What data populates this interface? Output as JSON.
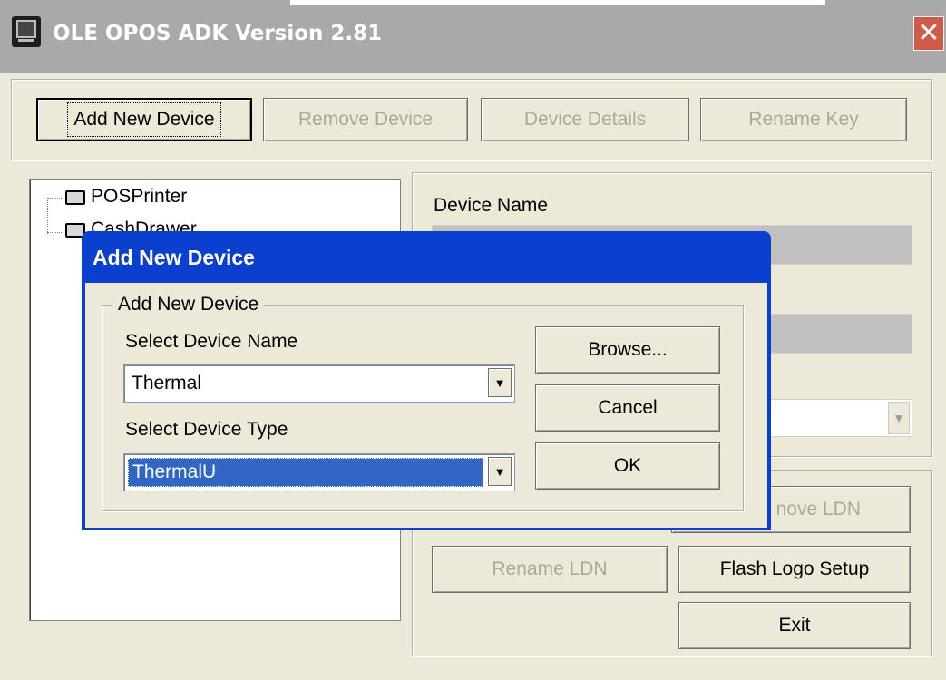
{
  "window": {
    "title": "OLE OPOS ADK Version 2.81",
    "close_glyph": "✕"
  },
  "toolbar": {
    "add_new_device": "Add New Device",
    "remove_device": "Remove Device",
    "device_details": "Device Details",
    "rename_key": "Rename Key"
  },
  "tree": {
    "items": [
      {
        "label": "POSPrinter",
        "icon": "device-icon"
      },
      {
        "label": "CashDrawer",
        "icon": "device-icon"
      }
    ]
  },
  "details": {
    "device_name_label": "Device Name"
  },
  "ldn_buttons": {
    "remove_ldn": "Remove LDN",
    "remove_ldn_visible": "nove LDN",
    "rename_ldn": "Rename LDN",
    "flash_logo_setup": "Flash Logo Setup",
    "exit": "Exit"
  },
  "dialog": {
    "title": "Add New Device",
    "group_label": "Add New Device",
    "select_device_name_label": "Select Device Name",
    "device_name_value": "Thermal",
    "select_device_type_label": "Select Device Type",
    "device_type_value": "ThermalU",
    "browse": "Browse...",
    "cancel": "Cancel",
    "ok": "OK"
  },
  "colors": {
    "dialog_title_bar": "#0b3fd0",
    "main_title_bar": "#a9a9a9",
    "selection": "#3166c5",
    "face": "#ece9d8"
  }
}
